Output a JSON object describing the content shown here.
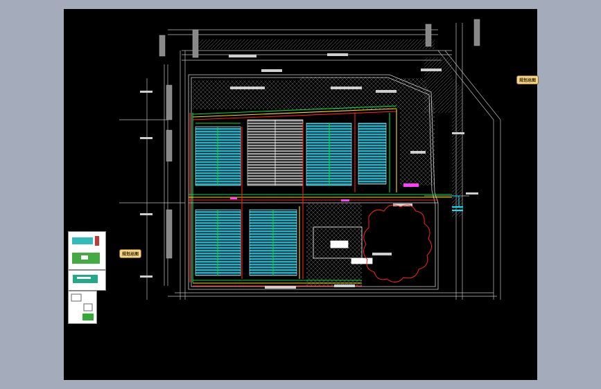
{
  "viewer": {
    "background": "#a4acbb",
    "canvas_color": "#000000"
  },
  "drawing": {
    "name_tag_right": "规划总图",
    "name_tag_left": "规划总图",
    "colors": {
      "outline": "#bfbfbf",
      "solar_panel": "#00bcd4",
      "panel_border": "#ffffff",
      "cable_green": "#00e040",
      "cable_red": "#ff2020",
      "cable_yellow": "#ffe000",
      "magenta": "#ff40ff",
      "hatch": "#7a7a7a",
      "revision_cloud": "#ff2020",
      "cyan_label": "#00e5ff"
    }
  }
}
